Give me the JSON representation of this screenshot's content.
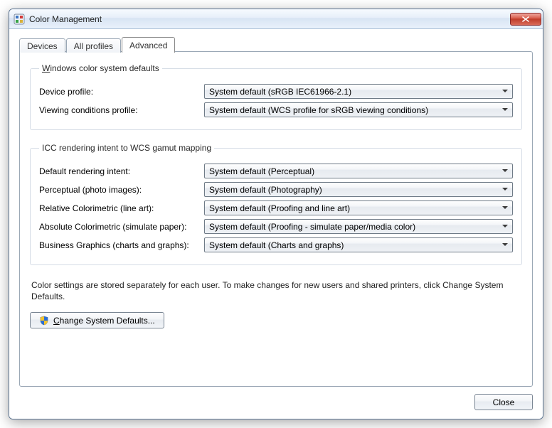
{
  "window": {
    "title": "Color Management"
  },
  "tabs": {
    "devices": "Devices",
    "all_profiles": "All profiles",
    "advanced": "Advanced",
    "active": "advanced"
  },
  "group1": {
    "legend": "Windows color system defaults",
    "rows": {
      "device_profile": {
        "label": "Device profile:",
        "value": "System default (sRGB IEC61966-2.1)"
      },
      "viewing_conditions": {
        "label": "Viewing conditions profile:",
        "value": "System default (WCS profile for sRGB viewing conditions)"
      }
    }
  },
  "group2": {
    "legend": "ICC  rendering intent to WCS gamut mapping",
    "rows": {
      "default_intent": {
        "label": "Default rendering intent:",
        "value": "System default (Perceptual)"
      },
      "perceptual": {
        "label": "Perceptual (photo images):",
        "value": "System default (Photography)"
      },
      "relative_colorimetric": {
        "label": "Relative Colorimetric (line art):",
        "value": "System default (Proofing and line art)"
      },
      "absolute_colorimetric": {
        "label": "Absolute Colorimetric (simulate paper):",
        "value": "System default (Proofing - simulate paper/media color)"
      },
      "business_graphics": {
        "label": "Business Graphics (charts and graphs):",
        "value": "System default (Charts and graphs)"
      }
    }
  },
  "note": "Color settings are stored separately for each user. To make changes for new users and shared printers, click Change System Defaults.",
  "buttons": {
    "change_defaults": "Change System Defaults...",
    "close": "Close"
  }
}
